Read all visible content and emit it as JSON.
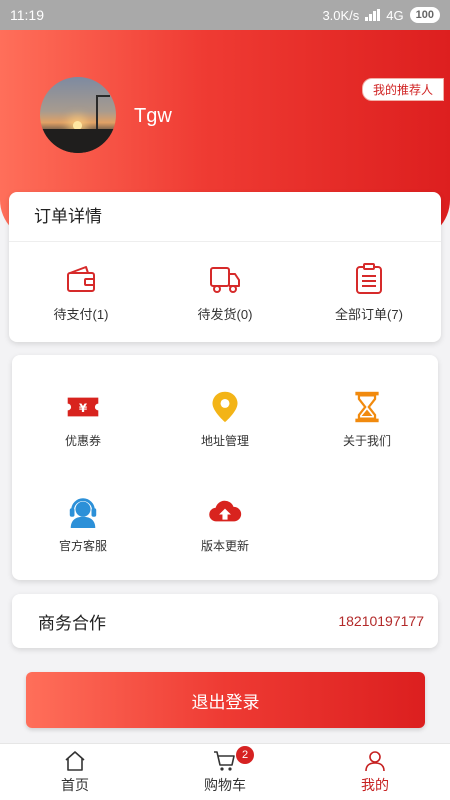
{
  "status_bar": {
    "time": "11:19",
    "speed": "3.0K/s",
    "network": "4G",
    "battery": "100"
  },
  "profile": {
    "username": "Tgw",
    "referrer_label": "我的推荐人"
  },
  "orders": {
    "title": "订单详情",
    "items": [
      {
        "label": "待支付(1)",
        "icon": "wallet-icon"
      },
      {
        "label": "待发货(0)",
        "icon": "truck-icon"
      },
      {
        "label": "全部订单(7)",
        "icon": "order-list-icon"
      }
    ]
  },
  "services": {
    "items": [
      {
        "label": "优惠券",
        "icon": "coupon-icon"
      },
      {
        "label": "地址管理",
        "icon": "location-pin-icon"
      },
      {
        "label": "关于我们",
        "icon": "hourglass-icon"
      },
      {
        "label": "官方客服",
        "icon": "customer-service-icon"
      },
      {
        "label": "版本更新",
        "icon": "cloud-upload-icon"
      }
    ]
  },
  "business": {
    "label": "商务合作",
    "phone": "18210197177"
  },
  "logout_label": "退出登录",
  "tabbar": {
    "items": [
      {
        "label": "首页",
        "icon": "home-icon"
      },
      {
        "label": "购物车",
        "icon": "cart-icon",
        "badge": "2"
      },
      {
        "label": "我的",
        "icon": "user-icon",
        "active": true
      }
    ]
  },
  "colors": {
    "accent": "#e52d2d",
    "coupon": "#d8231e",
    "pin": "#f3b417",
    "hourglass": "#f18a0e",
    "service": "#2c90d8"
  }
}
